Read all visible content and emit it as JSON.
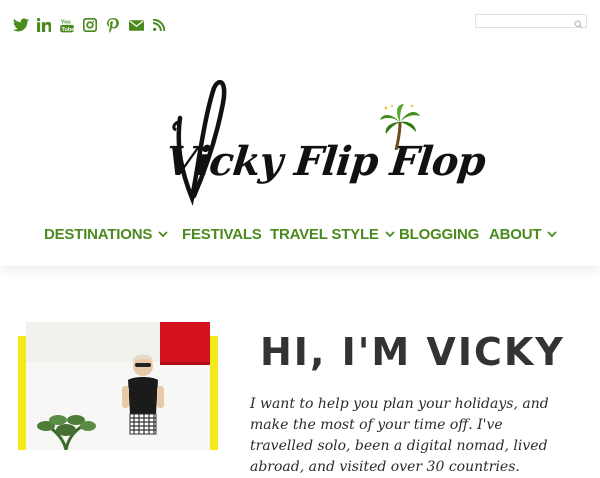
{
  "social": {
    "icons": [
      "twitter-icon",
      "linkedin-icon",
      "youtube-icon",
      "instagram-icon",
      "pinterest-icon",
      "email-icon",
      "rss-icon"
    ],
    "color": "#4b8a1e"
  },
  "search": {
    "placeholder": ""
  },
  "logo": {
    "text": "Vicky Flip Flop"
  },
  "nav": {
    "items": [
      {
        "label": "DESTINATIONS",
        "has_dropdown": true
      },
      {
        "label": "FESTIVALS",
        "has_dropdown": false
      },
      {
        "label": "TRAVEL STYLE",
        "has_dropdown": true
      },
      {
        "label": "BLOGGING",
        "has_dropdown": false
      },
      {
        "label": "ABOUT",
        "has_dropdown": true
      }
    ],
    "color": "#4b8a1e"
  },
  "intro": {
    "heading": "HI, I'M VICKY",
    "body": "I want to help you plan your holidays, and make the most of your time off. I've travelled solo, been a digital nomad, lived abroad, and visited over 30 countries."
  },
  "colors": {
    "accent_yellow": "#f5e81a",
    "shutter_red": "#d3121e"
  }
}
